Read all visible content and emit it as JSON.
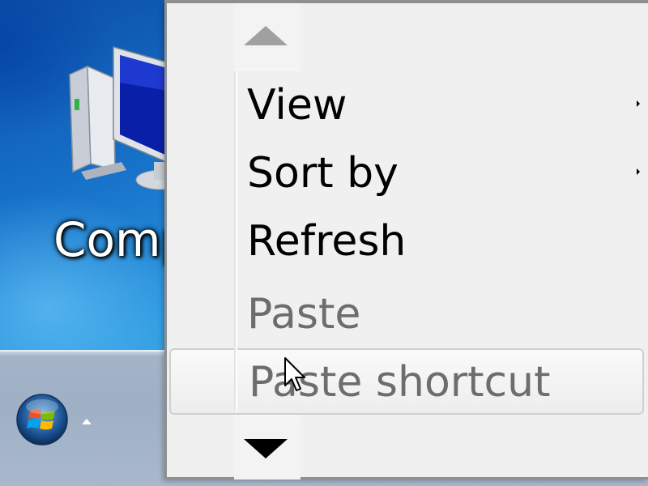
{
  "desktop": {
    "icons": [
      {
        "label": "Comp",
        "icon": "computer-icon"
      }
    ]
  },
  "taskbar": {
    "start_button_icon": "windows-logo-icon",
    "tray_arrow_icon": "show-hidden-icons-arrow"
  },
  "context_menu": {
    "scroll_up_icon": "scroll-up-triangle-icon",
    "scroll_down_icon": "scroll-down-triangle-icon",
    "items": [
      {
        "label": "View",
        "has_submenu": true,
        "enabled": true
      },
      {
        "label": "Sort by",
        "has_submenu": true,
        "enabled": true
      },
      {
        "label": "Refresh",
        "has_submenu": false,
        "enabled": true
      },
      {
        "label": "Paste",
        "has_submenu": false,
        "enabled": false
      },
      {
        "label": "Paste shortcut",
        "has_submenu": false,
        "enabled": false,
        "hovered": true
      }
    ]
  },
  "colors": {
    "menu_background": "#f0f0f0",
    "menu_border": "#8f8f8f",
    "disabled_text": "#6d6d6d",
    "desktop_blue": "#1670c8",
    "taskbar": "#a4b4c8"
  }
}
